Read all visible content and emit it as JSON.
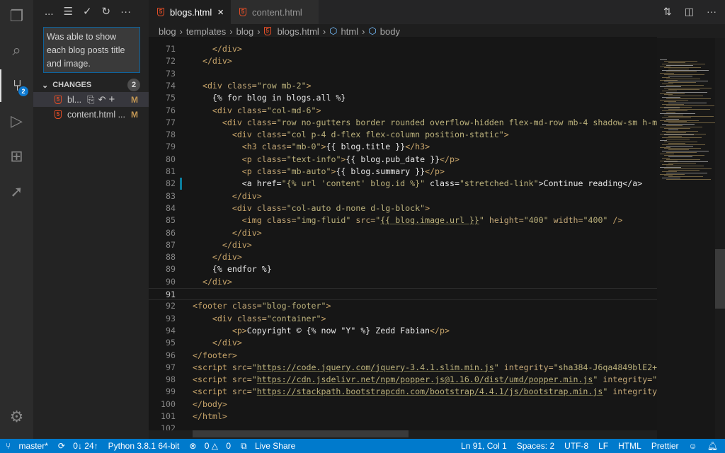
{
  "activity_bar": {
    "scm_badge": "2"
  },
  "sidebar": {
    "toolbar": {
      "more_left": "...",
      "tree": "☰",
      "commit": "✓",
      "refresh": "↻",
      "more": "···"
    },
    "commit_message": "Was able to show each blog posts title and image.",
    "changes_label": "CHANGES",
    "changes_count": "2",
    "files": [
      {
        "name": "bl...",
        "status": "M"
      },
      {
        "name": "content.html ...",
        "status": "M"
      }
    ]
  },
  "tabs": [
    {
      "label": "blogs.html",
      "close": "×"
    },
    {
      "label": "content.html"
    }
  ],
  "breadcrumb": [
    "blog",
    "templates",
    "blog",
    "blogs.html",
    "html",
    "body"
  ],
  "editor": {
    "lines": [
      {
        "n": "71",
        "seg": [
          [
            "t",
            "    </div>"
          ]
        ]
      },
      {
        "n": "72",
        "seg": [
          [
            "t",
            "  </div>"
          ]
        ]
      },
      {
        "n": "73",
        "seg": []
      },
      {
        "n": "74",
        "seg": [
          [
            "t",
            "  <div "
          ],
          [
            "a",
            "class="
          ],
          [
            "s",
            "\"row mb-2\""
          ],
          [
            "t",
            ">"
          ]
        ]
      },
      {
        "n": "75",
        "seg": [
          [
            "w",
            "    {% for blog in blogs.all %}"
          ]
        ]
      },
      {
        "n": "76",
        "seg": [
          [
            "t",
            "    <div "
          ],
          [
            "a",
            "class="
          ],
          [
            "s",
            "\"col-md-6\""
          ],
          [
            "t",
            ">"
          ]
        ]
      },
      {
        "n": "77",
        "seg": [
          [
            "t",
            "      <div "
          ],
          [
            "a",
            "class="
          ],
          [
            "s",
            "\"row no-gutters border rounded overflow-hidden flex-md-row mb-4 shadow-sm h-m"
          ]
        ]
      },
      {
        "n": "78",
        "seg": [
          [
            "t",
            "        <div "
          ],
          [
            "a",
            "class="
          ],
          [
            "s",
            "\"col p-4 d-flex flex-column position-static\""
          ],
          [
            "t",
            ">"
          ]
        ]
      },
      {
        "n": "79",
        "seg": [
          [
            "t",
            "          <h3 "
          ],
          [
            "a",
            "class="
          ],
          [
            "s",
            "\"mb-0\""
          ],
          [
            "t",
            ">"
          ],
          [
            "w",
            "{{ blog.title }}"
          ],
          [
            "t",
            "</h3>"
          ]
        ]
      },
      {
        "n": "80",
        "seg": [
          [
            "t",
            "          <p "
          ],
          [
            "a",
            "class="
          ],
          [
            "s",
            "\"text-info\""
          ],
          [
            "t",
            ">"
          ],
          [
            "w",
            "{{ blog.pub_date }}"
          ],
          [
            "t",
            "</p>"
          ]
        ]
      },
      {
        "n": "81",
        "seg": [
          [
            "t",
            "          <p "
          ],
          [
            "a",
            "class="
          ],
          [
            "s",
            "\"mb-auto\""
          ],
          [
            "t",
            ">"
          ],
          [
            "w",
            "{{ blog.summary }}"
          ],
          [
            "t",
            "</p>"
          ]
        ]
      },
      {
        "n": "82",
        "mod": true,
        "seg": [
          [
            "w",
            "          <a href="
          ],
          [
            "s",
            "\"{% url 'content' blog.id %}\""
          ],
          [
            "w",
            " class="
          ],
          [
            "s",
            "\"stretched-link\""
          ],
          [
            "w",
            ">Continue reading</a>"
          ]
        ]
      },
      {
        "n": "83",
        "seg": [
          [
            "t",
            "        </div>"
          ]
        ]
      },
      {
        "n": "84",
        "seg": [
          [
            "t",
            "        <div "
          ],
          [
            "a",
            "class="
          ],
          [
            "s",
            "\"col-auto d-none d-lg-block\""
          ],
          [
            "t",
            ">"
          ]
        ]
      },
      {
        "n": "85",
        "seg": [
          [
            "t",
            "          <img "
          ],
          [
            "a",
            "class="
          ],
          [
            "s",
            "\"img-fluid\" "
          ],
          [
            "a",
            "src="
          ],
          [
            "s",
            "\""
          ],
          [
            "u",
            "{{ blog.image.url }}"
          ],
          [
            "s",
            "\" "
          ],
          [
            "a",
            "height="
          ],
          [
            "s",
            "\"400\" "
          ],
          [
            "a",
            "width="
          ],
          [
            "s",
            "\"400\" "
          ],
          [
            "t",
            "/>"
          ]
        ]
      },
      {
        "n": "86",
        "seg": [
          [
            "t",
            "        </div>"
          ]
        ]
      },
      {
        "n": "87",
        "seg": [
          [
            "t",
            "      </div>"
          ]
        ]
      },
      {
        "n": "88",
        "seg": [
          [
            "t",
            "    </div>"
          ]
        ]
      },
      {
        "n": "89",
        "seg": [
          [
            "w",
            "    {% endfor %}"
          ]
        ]
      },
      {
        "n": "90",
        "seg": [
          [
            "t",
            "  </div>"
          ]
        ]
      },
      {
        "n": "91",
        "cur": true,
        "seg": []
      },
      {
        "n": "92",
        "seg": [
          [
            "t",
            "<footer "
          ],
          [
            "a",
            "class="
          ],
          [
            "s",
            "\"blog-footer\""
          ],
          [
            "t",
            ">"
          ]
        ]
      },
      {
        "n": "93",
        "seg": [
          [
            "t",
            "    <div "
          ],
          [
            "a",
            "class="
          ],
          [
            "s",
            "\"container\""
          ],
          [
            "t",
            ">"
          ]
        ]
      },
      {
        "n": "94",
        "seg": [
          [
            "t",
            "        <p>"
          ],
          [
            "w",
            "Copyright © {% now \"Y\" %} Zedd Fabian"
          ],
          [
            "t",
            "</p>"
          ]
        ]
      },
      {
        "n": "95",
        "seg": [
          [
            "t",
            "    </div>"
          ]
        ]
      },
      {
        "n": "96",
        "seg": [
          [
            "t",
            "</footer>"
          ]
        ]
      },
      {
        "n": "97",
        "seg": [
          [
            "t",
            "<script "
          ],
          [
            "a",
            "src="
          ],
          [
            "s",
            "\""
          ],
          [
            "u",
            "https://code.jquery.com/jquery-3.4.1.slim.min.js"
          ],
          [
            "s",
            "\" "
          ],
          [
            "a",
            "integrity="
          ],
          [
            "s",
            "\"sha384-J6qa4849blE2+"
          ]
        ]
      },
      {
        "n": "98",
        "seg": [
          [
            "t",
            "<script "
          ],
          [
            "a",
            "src="
          ],
          [
            "s",
            "\""
          ],
          [
            "u",
            "https://cdn.jsdelivr.net/npm/popper.js@1.16.0/dist/umd/popper.min.js"
          ],
          [
            "s",
            "\" "
          ],
          [
            "a",
            "integrity="
          ],
          [
            "s",
            "\""
          ]
        ]
      },
      {
        "n": "99",
        "seg": [
          [
            "t",
            "<script "
          ],
          [
            "a",
            "src="
          ],
          [
            "s",
            "\""
          ],
          [
            "u",
            "https://stackpath.bootstrapcdn.com/bootstrap/4.4.1/js/bootstrap.min.js"
          ],
          [
            "s",
            "\" "
          ],
          [
            "a",
            "integrity="
          ]
        ]
      },
      {
        "n": "100",
        "seg": [
          [
            "t",
            "</body>"
          ]
        ]
      },
      {
        "n": "101",
        "seg": [
          [
            "t",
            "</html>"
          ]
        ]
      },
      {
        "n": "102",
        "seg": []
      }
    ]
  },
  "status": {
    "branch": "master*",
    "sync": "0↓ 24↑",
    "python": "Python 3.8.1 64-bit",
    "errors": "0",
    "warnings": "0",
    "liveshare": "Live Share",
    "position": "Ln 91, Col 1",
    "spaces": "Spaces: 2",
    "encoding": "UTF-8",
    "eol": "LF",
    "language": "HTML",
    "formatter": "Prettier"
  },
  "colors": {
    "status_bar": "#007acc",
    "html_icon": "#e44d26",
    "modified": "#c09553"
  }
}
